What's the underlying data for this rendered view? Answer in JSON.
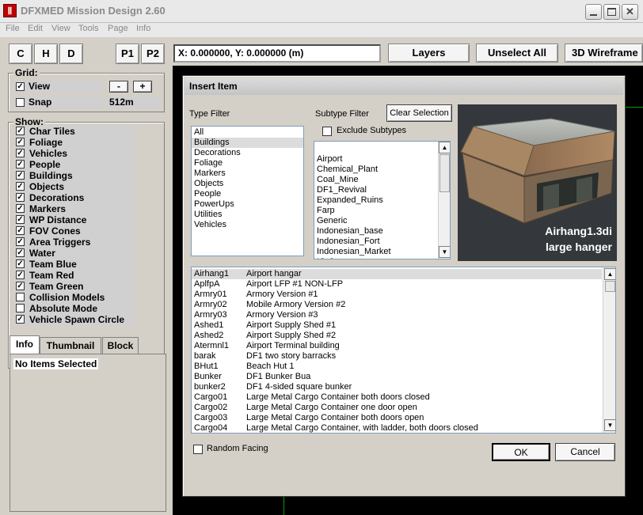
{
  "window": {
    "title": "DFXMED Mission Design 2.60",
    "icon": "app-logo-icon"
  },
  "menu": [
    "File",
    "Edit",
    "View",
    "Tools",
    "Page",
    "Info"
  ],
  "view_buttons": [
    "C",
    "H",
    "D"
  ],
  "page_buttons": [
    "P1",
    "P2"
  ],
  "grid": {
    "label": "Grid:",
    "view_label": "View",
    "view_checked": true,
    "minus": "-",
    "plus": "+",
    "snap_label": "Snap",
    "snap_checked": false,
    "snap_value": "512m"
  },
  "show": {
    "label": "Show:",
    "items": [
      {
        "label": "Char Tiles",
        "checked": true
      },
      {
        "label": "Foliage",
        "checked": true
      },
      {
        "label": "Vehicles",
        "checked": true
      },
      {
        "label": "People",
        "checked": true
      },
      {
        "label": "Buildings",
        "checked": true
      },
      {
        "label": "Objects",
        "checked": true
      },
      {
        "label": "Decorations",
        "checked": true
      },
      {
        "label": "Markers",
        "checked": true
      },
      {
        "label": "WP Distance",
        "checked": true
      },
      {
        "label": "FOV Cones",
        "checked": true
      },
      {
        "label": "Area Triggers",
        "checked": true
      },
      {
        "label": "Water",
        "checked": true
      },
      {
        "label": "Team Blue",
        "checked": true
      },
      {
        "label": "Team Red",
        "checked": true
      },
      {
        "label": "Team Green",
        "checked": true
      },
      {
        "label": "Collision Models",
        "checked": false
      },
      {
        "label": "Absolute Mode",
        "checked": false
      },
      {
        "label": "Vehicle Spawn Circle",
        "checked": true
      }
    ]
  },
  "tabs": [
    "Info",
    "Thumbnail",
    "Block"
  ],
  "info_text": "No Items Selected",
  "coords": "X: 0.000000, Y: 0.000000 (m)",
  "toolbar": {
    "layers": "Layers",
    "unselect_all": "Unselect All",
    "wireframe": "3D Wireframe"
  },
  "dialog": {
    "title": "Insert Item",
    "type_filter_label": "Type Filter",
    "type_filter_items": [
      "All",
      "Buildings",
      "Decorations",
      "Foliage",
      "Markers",
      "Objects",
      "People",
      "PowerUps",
      "Utilities",
      "Vehicles"
    ],
    "type_filter_selected": 1,
    "subtype_filter_label": "Subtype Filter",
    "clear_selection": "Clear Selection",
    "exclude_subtypes": "Exclude Subtypes",
    "subtype_items": [
      "Airport",
      "Chemical_Plant",
      "Coal_Mine",
      "DF1_Revival",
      "Expanded_Ruins",
      "Farp",
      "Generic",
      "Indonesian_base",
      "Indonesian_Fort",
      "Indonesian_Market",
      "IO_base"
    ],
    "preview_name": "Airhang1.3di",
    "preview_desc": "large hanger",
    "items": [
      {
        "code": "Airhang1",
        "desc": "Airport hangar"
      },
      {
        "code": "AplfpA",
        "desc": "Airport LFP #1 NON-LFP"
      },
      {
        "code": "Armry01",
        "desc": "Armory Version #1"
      },
      {
        "code": "Armry02",
        "desc": "Mobile Armory Version #2"
      },
      {
        "code": "Armry03",
        "desc": "Armory Version #3"
      },
      {
        "code": "Ashed1",
        "desc": "Airport Supply Shed #1"
      },
      {
        "code": "Ashed2",
        "desc": "Airport Supply Shed #2"
      },
      {
        "code": "Atermnl1",
        "desc": "Airport Terminal building"
      },
      {
        "code": "barak",
        "desc": "DF1 two story barracks"
      },
      {
        "code": "BHut1",
        "desc": "Beach Hut 1"
      },
      {
        "code": "Bunker",
        "desc": "DF1 Bunker Bua"
      },
      {
        "code": "bunker2",
        "desc": "DF1 4-sided square bunker"
      },
      {
        "code": "Cargo01",
        "desc": "Large Metal Cargo Container both doors closed"
      },
      {
        "code": "Cargo02",
        "desc": "Large Metal Cargo Container one door open"
      },
      {
        "code": "Cargo03",
        "desc": "Large Metal Cargo Container both doors open"
      },
      {
        "code": "Cargo04",
        "desc": "Large Metal Cargo Container, with ladder, both doors closed"
      }
    ],
    "items_selected": 0,
    "random_facing": "Random Facing",
    "ok": "OK",
    "cancel": "Cancel"
  }
}
